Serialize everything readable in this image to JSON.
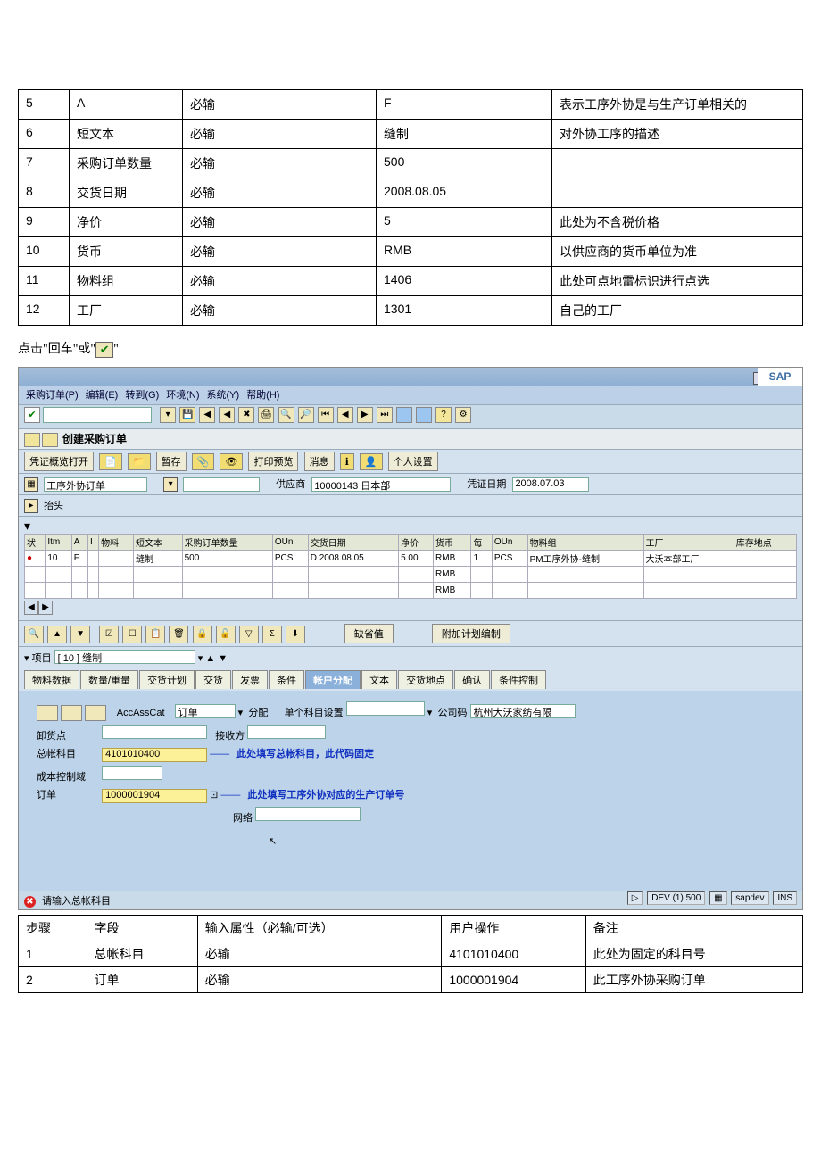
{
  "t1": {
    "rows": [
      {
        "n": "5",
        "f": "A",
        "p": "必输",
        "u": "F",
        "r": "表示工序外协是与生产订单相关的"
      },
      {
        "n": "6",
        "f": "短文本",
        "p": "必输",
        "u": "缝制",
        "r": "对外协工序的描述"
      },
      {
        "n": "7",
        "f": "采购订单数量",
        "p": "必输",
        "u": "500",
        "r": ""
      },
      {
        "n": "8",
        "f": "交货日期",
        "p": "必输",
        "u": "2008.08.05",
        "r": ""
      },
      {
        "n": "9",
        "f": "净价",
        "p": "必输",
        "u": "5",
        "r": "此处为不含税价格"
      },
      {
        "n": "10",
        "f": "货币",
        "p": "必输",
        "u": "RMB",
        "r": "以供应商的货币单位为准"
      },
      {
        "n": "11",
        "f": "物料组",
        "p": "必输",
        "u": "1406",
        "r": "此处可点地雷标识进行点选"
      },
      {
        "n": "12",
        "f": "工厂",
        "p": "必输",
        "u": "1301",
        "r": "自己的工厂"
      }
    ]
  },
  "instr": {
    "pre": "点击\"回车\"或\"",
    "suf": "\""
  },
  "menu": {
    "items": [
      "采购订单(P)",
      "编辑(E)",
      "转到(G)",
      "环境(N)",
      "系统(Y)",
      "帮助(H)"
    ]
  },
  "title": "创建采购订单",
  "stbar": {
    "b": [
      "凭证概览打开",
      "暂存",
      "打印预览",
      "消息",
      "个人设置"
    ]
  },
  "hdr": {
    "type": "工序外协订单",
    "supLbl": "供应商",
    "sup": "10000143 日本部",
    "dateLbl": "凭证日期",
    "date": "2008.07.03",
    "hd": "抬头"
  },
  "grid": {
    "cols": [
      "状",
      "Itm",
      "A",
      "I",
      "物料",
      "短文本",
      "采购订单数量",
      "OUn",
      "交货日期",
      "净价",
      "货币",
      "每",
      "OUn",
      "物料组",
      "工厂",
      "库存地点"
    ],
    "row": {
      "itm": "10",
      "a": "F",
      "txt": "缝制",
      "qty": "500",
      "ou1": "PCS",
      "dd": "D",
      "ddate": "2008.08.05",
      "np": "5.00",
      "cur": "RMB",
      "per": "1",
      "ou2": "PCS",
      "mg": "PM工序外协-缝制",
      "plant": "大沃本部工厂"
    }
  },
  "tbox": {
    "btn1": "缺省值",
    "btn2": "附加计划编制"
  },
  "item": {
    "lbl": "项目",
    "val": "[ 10 ] 缝制"
  },
  "tabs": [
    "物料数据",
    "数量/重量",
    "交货计划",
    "交货",
    "发票",
    "条件",
    "帐户分配",
    "文本",
    "交货地点",
    "确认",
    "条件控制"
  ],
  "tabActive": 6,
  "acc": {
    "accCat": "AccAssCat",
    "accCatV": "订单",
    "dist": "分配",
    "single": "单个科目设置",
    "comp": "公司码",
    "compV": "杭州大沃家纺有限",
    "gl": "卸货点",
    "recv": "接收方",
    "glLbl": "总帐科目",
    "glV": "4101010400",
    "glHint": "此处填写总帐科目，此代码固定",
    "cc": "成本控制域",
    "ord": "订单",
    "ordV": "1000001904",
    "ordHint": "此处填写工序外协对应的生产订单号",
    "net": "网络"
  },
  "status": {
    "err": "请输入总帐科目",
    "dev": "DEV (1) 500",
    "srv": "sapdev",
    "ins": "INS"
  },
  "t2": {
    "head": [
      "步骤",
      "字段",
      "输入属性（必输/可选）",
      "用户操作",
      "备注"
    ],
    "rows": [
      {
        "n": "1",
        "f": "总帐科目",
        "p": "必输",
        "u": "4101010400",
        "r": "此处为固定的科目号"
      },
      {
        "n": "2",
        "f": "订单",
        "p": "必输",
        "u": "1000001904",
        "r": "此工序外协采购订单"
      }
    ]
  }
}
